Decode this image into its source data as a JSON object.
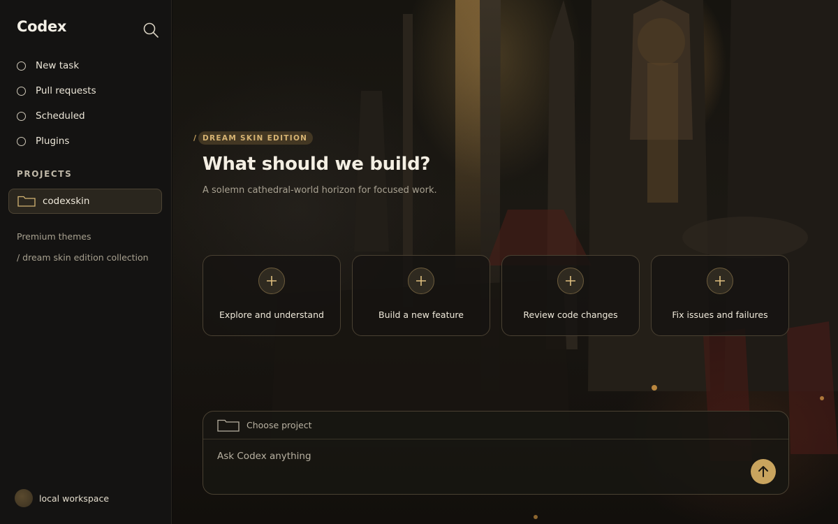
{
  "app": {
    "title": "Codex"
  },
  "sidebar": {
    "search_icon": "search-icon",
    "items": [
      {
        "label": "New task",
        "icon": "circle-icon"
      },
      {
        "label": "Pull requests",
        "icon": "circle-icon"
      },
      {
        "label": "Scheduled",
        "icon": "circle-icon"
      },
      {
        "label": "Plugins",
        "icon": "circle-icon"
      }
    ],
    "projects_heading": "PROJECTS",
    "projects": [
      {
        "label": "codexskin",
        "icon": "folder-icon"
      }
    ],
    "links": [
      "Premium themes",
      "/ dream skin edition collection"
    ],
    "workspace": {
      "label": "local workspace"
    }
  },
  "hero": {
    "eyebrow_slash": "/",
    "eyebrow": "DREAM SKIN EDITION",
    "title": "What should we build?",
    "subtitle": "A solemn cathedral-world horizon for focused work."
  },
  "cards": [
    {
      "label": "Explore and understand",
      "icon": "plus-icon"
    },
    {
      "label": "Build a new feature",
      "icon": "plus-icon"
    },
    {
      "label": "Review code changes",
      "icon": "plus-icon"
    },
    {
      "label": "Fix issues and failures",
      "icon": "plus-icon"
    }
  ],
  "composer": {
    "project_label": "Choose project",
    "placeholder": "Ask Codex anything",
    "send_icon": "arrow-up-icon"
  },
  "colors": {
    "accent": "#c9a45e",
    "background": "#0d0c0b",
    "sidebar": "#141312"
  }
}
